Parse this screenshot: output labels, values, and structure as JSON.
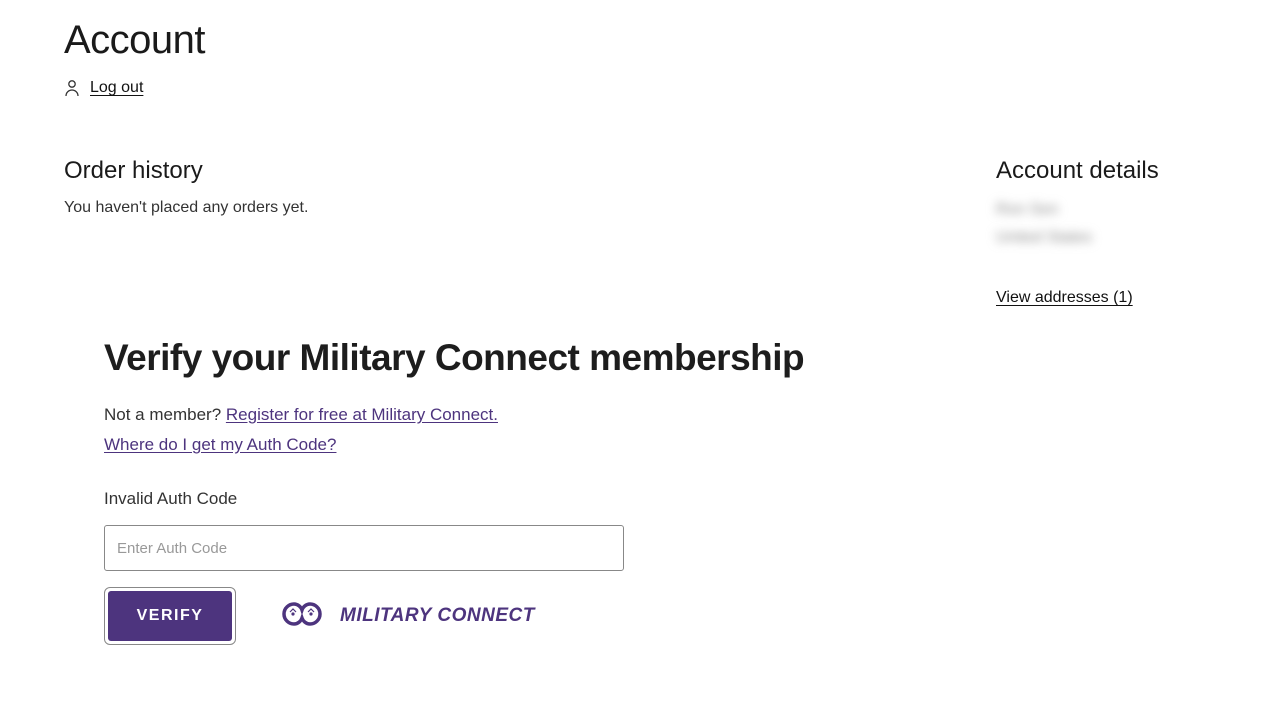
{
  "page": {
    "title": "Account"
  },
  "logout": {
    "label": "Log out"
  },
  "order_history": {
    "title": "Order history",
    "empty_message": "You haven't placed any orders yet."
  },
  "account_details": {
    "title": "Account details",
    "name_masked": "Ron Sen",
    "country_masked": "United States",
    "view_addresses_label": "View addresses (1)"
  },
  "verify": {
    "heading": "Verify your Military Connect membership",
    "not_member_prefix": "Not a member? ",
    "register_link": "Register for free at Military Connect.",
    "where_auth_link": "Where do I get my Auth Code?",
    "error_msg": "Invalid Auth Code",
    "input_placeholder": "Enter Auth Code",
    "button_label": "VERIFY",
    "logo_text": "MILITARY CONNECT"
  }
}
